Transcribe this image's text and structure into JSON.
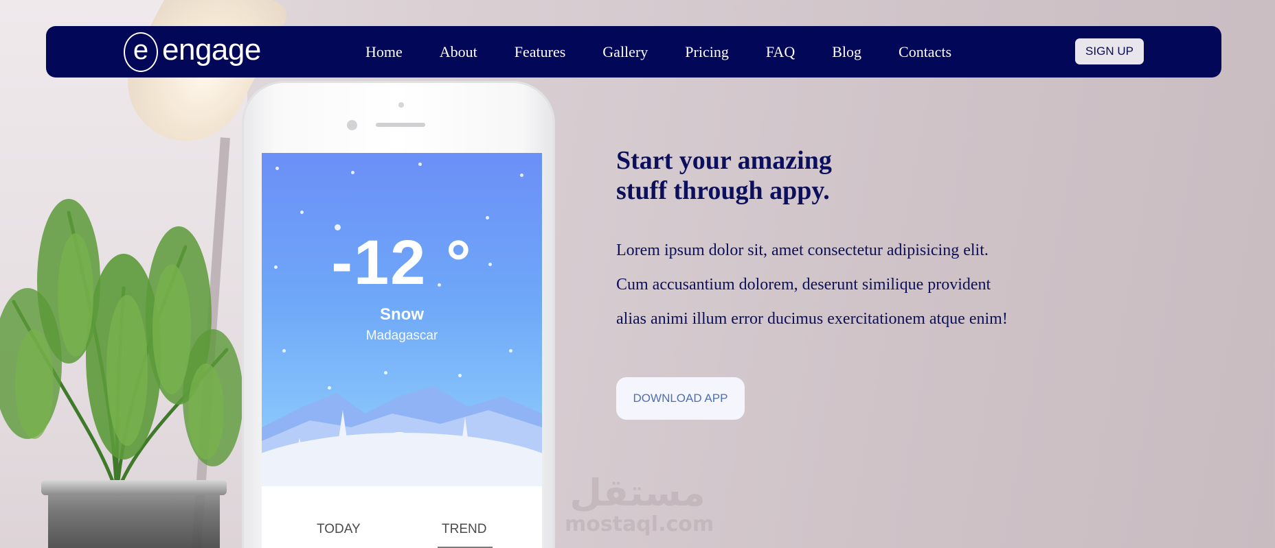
{
  "brand": {
    "mark": "e",
    "name": "engage"
  },
  "nav": {
    "links": [
      "Home",
      "About",
      "Features",
      "Gallery",
      "Pricing",
      "FAQ",
      "Blog",
      "Contacts"
    ],
    "signup_label": "SIGN UP"
  },
  "phone": {
    "temperature": "-12 °",
    "condition": "Snow",
    "location": "Madagascar",
    "tabs": [
      "TODAY",
      "TREND"
    ],
    "active_tab": "TREND"
  },
  "hero": {
    "title_line1": "Start your amazing",
    "title_line2": "stuff through appy.",
    "body_line1": "Lorem ipsum dolor sit, amet consectetur adipisicing elit.",
    "body_line2": "Cum accusantium dolorem, deserunt similique provident",
    "body_line3": "alias animi illum error ducimus exercitationem atque enim!",
    "download_label": "DOWNLOAD APP"
  },
  "watermark": {
    "arabic": "مستقل",
    "latin": "mostaql.com"
  },
  "colors": {
    "navbar_bg": "#030758",
    "heading_text": "#0b0f5c",
    "signup_bg": "#e8e6ec",
    "download_text": "#4d6fb0",
    "weather_gradient_top": "#6b8ff7",
    "weather_gradient_bottom": "#a8d6fc"
  },
  "icons": [
    "engage-logo-icon",
    "phone-camera-icon",
    "snowflake-dot-icon"
  ]
}
